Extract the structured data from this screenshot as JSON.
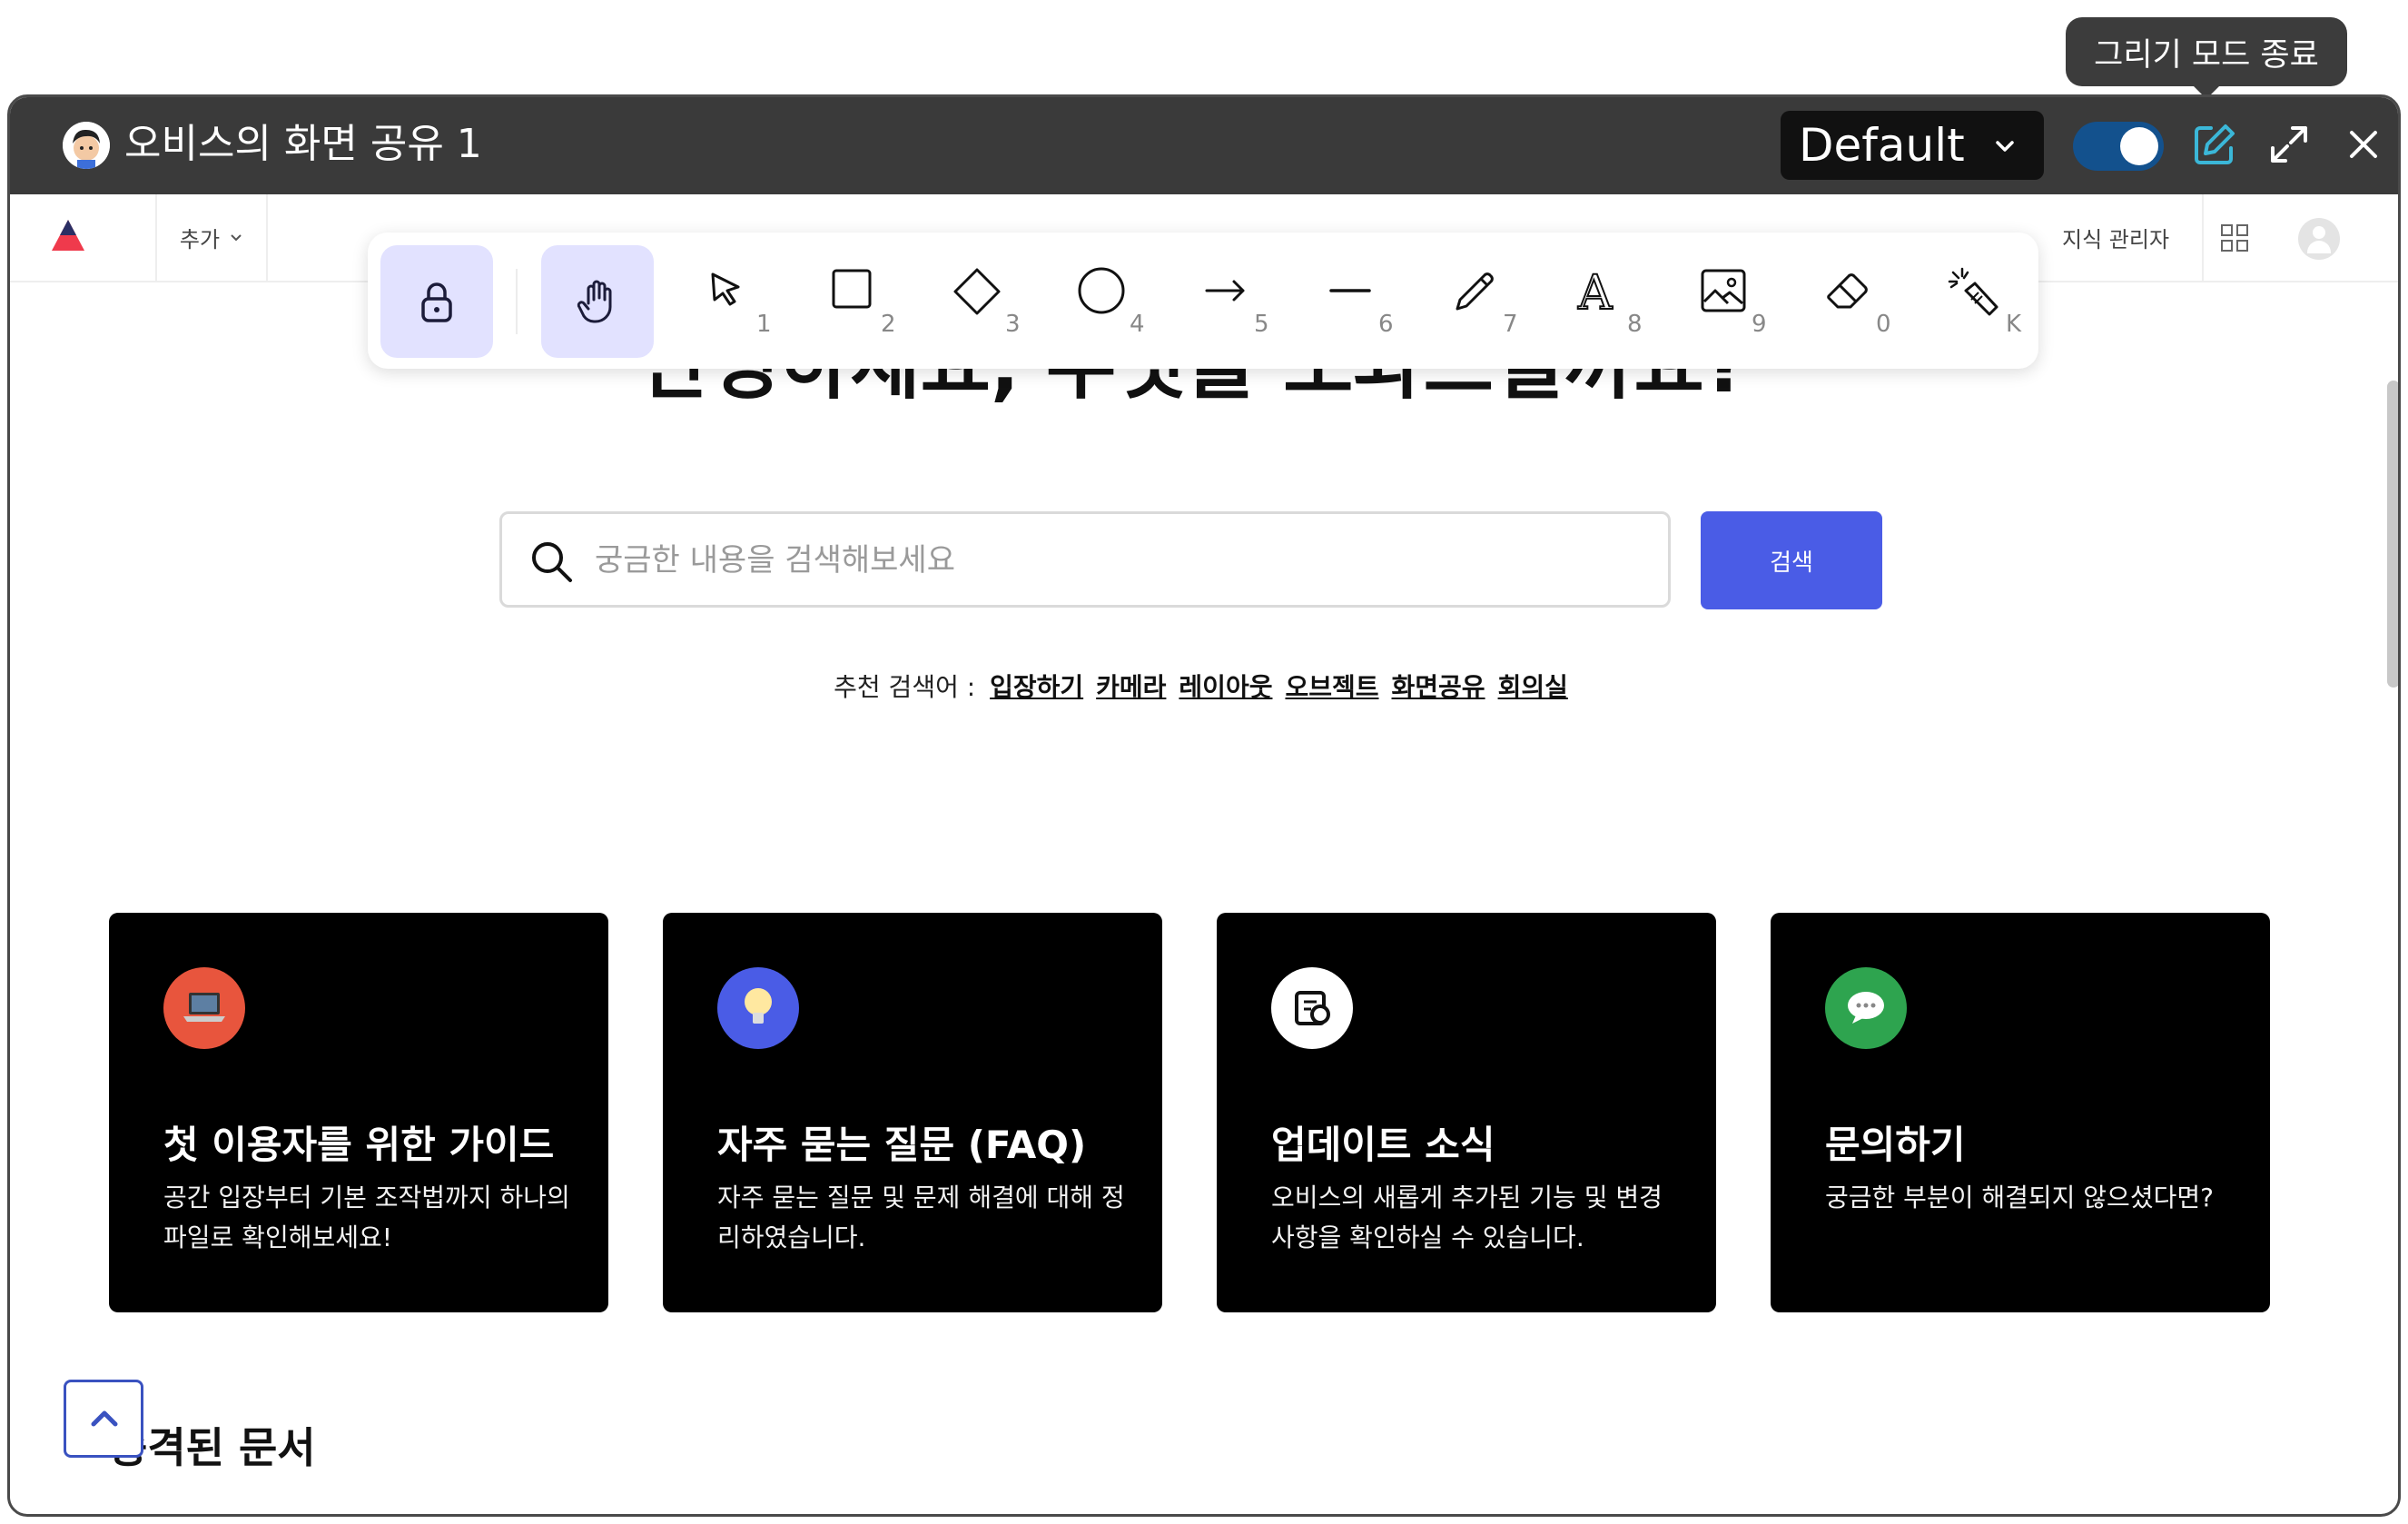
{
  "tooltip": "그리기 모드 종료",
  "window": {
    "title": "오비스의 화면 공유 1",
    "mode_select": "Default"
  },
  "app_header": {
    "add_menu": "추가",
    "admin_link": "지식 관리자"
  },
  "hero_title": "안녕하세요, 무엇을 도와드릴까요?",
  "drawing_toolbar": {
    "tools": [
      {
        "name": "select-tool",
        "key": "1"
      },
      {
        "name": "rectangle-tool",
        "key": "2"
      },
      {
        "name": "diamond-tool",
        "key": "3"
      },
      {
        "name": "ellipse-tool",
        "key": "4"
      },
      {
        "name": "arrow-tool",
        "key": "5"
      },
      {
        "name": "line-tool",
        "key": "6"
      },
      {
        "name": "pencil-tool",
        "key": "7"
      },
      {
        "name": "text-tool",
        "key": "8"
      },
      {
        "name": "image-tool",
        "key": "9"
      },
      {
        "name": "eraser-tool",
        "key": "0"
      },
      {
        "name": "laser-tool",
        "key": "K"
      }
    ]
  },
  "search": {
    "placeholder": "궁금한 내용을 검색해보세요",
    "button": "검색"
  },
  "suggestions": {
    "label": "추천 검색어 :",
    "terms": [
      "입장하기",
      "카메라",
      "레이아웃",
      "오브젝트",
      "화면공유",
      "회의실"
    ]
  },
  "cards": [
    {
      "title": "첫 이용자를 위한 가이드",
      "desc": "공간 입장부터 기본 조작법까지 하나의 파일로 확인해보세요!",
      "icon": "laptop-icon",
      "color": "#e8553d"
    },
    {
      "title": "자주 묻는 질문 (FAQ)",
      "desc": "자주 묻는 질문 및 문제 해결에 대해 정리하였습니다.",
      "icon": "lightbulb-icon",
      "color": "#4a5ce6"
    },
    {
      "title": "업데이트 소식",
      "desc": "오비스의 새롭게 추가된 기능 및 변경 사항을 확인하실 수 있습니다.",
      "icon": "update-icon",
      "color": "#ffffff"
    },
    {
      "title": "문의하기",
      "desc": "궁금한 부분이 해결되지 않으셨다면?",
      "icon": "chat-bubble-icon",
      "color": "#2ea44f"
    }
  ],
  "section_title": "승격된 문서"
}
